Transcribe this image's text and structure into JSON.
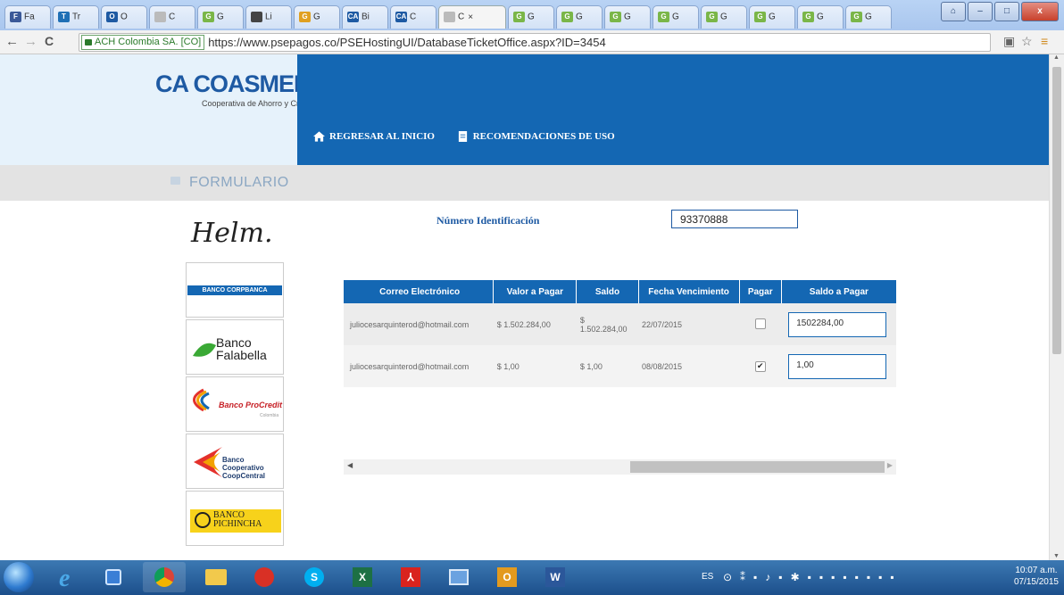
{
  "browser": {
    "tabs": [
      {
        "label": "Fa",
        "fav": "F",
        "color": "#3b5998"
      },
      {
        "label": "Tr",
        "fav": "T",
        "color": "#1f6fb5"
      },
      {
        "label": "O",
        "fav": "O",
        "color": "#1e5aa3"
      },
      {
        "label": "C",
        "fav": "",
        "color": "#bbbbbb"
      },
      {
        "label": "G",
        "fav": "G",
        "color": "#7ab648"
      },
      {
        "label": "Li",
        "fav": "",
        "color": "#444444"
      },
      {
        "label": "G",
        "fav": "G",
        "color": "#e0a020"
      },
      {
        "label": "Bi",
        "fav": "CA",
        "color": "#1e5aa3"
      },
      {
        "label": "C",
        "fav": "CA",
        "color": "#1e5aa3"
      },
      {
        "label": "C",
        "fav": "",
        "color": "#bbbbbb",
        "active": true
      },
      {
        "label": "G",
        "fav": "G",
        "color": "#7ab648"
      },
      {
        "label": "G",
        "fav": "G",
        "color": "#7ab648"
      },
      {
        "label": "G",
        "fav": "G",
        "color": "#7ab648"
      },
      {
        "label": "G",
        "fav": "G",
        "color": "#7ab648"
      },
      {
        "label": "G",
        "fav": "G",
        "color": "#7ab648"
      },
      {
        "label": "G",
        "fav": "G",
        "color": "#7ab648"
      },
      {
        "label": "G",
        "fav": "G",
        "color": "#7ab648"
      },
      {
        "label": "G",
        "fav": "G",
        "color": "#7ab648"
      }
    ],
    "ev_label": "ACH Colombia SA. [CO]",
    "url": "https://www.psepagos.co/PSEHostingUI/DatabaseTicketOffice.aspx?ID=3454"
  },
  "header": {
    "logo_main": "COASMEDAS",
    "logo_sub": "Cooperativa de Ahorro y Crédito",
    "nav": [
      {
        "label": "REGRESAR AL INICIO",
        "icon": "home-icon"
      },
      {
        "label": "RECOMENDACIONES DE USO",
        "icon": "document-icon"
      }
    ]
  },
  "form": {
    "title": "FORMULARIO",
    "id_label": "Número Identificación",
    "id_value": "93370888"
  },
  "banks": [
    {
      "name": "Helm."
    },
    {
      "name": "BANCO CORPBANCA"
    },
    {
      "name": "Banco Falabella"
    },
    {
      "name": "Banco ProCredit",
      "sub": "Colombia"
    },
    {
      "name": "Banco Cooperativo CoopCentral"
    },
    {
      "name": "BANCO PICHINCHA"
    }
  ],
  "table": {
    "headers": [
      "Correo Electrónico",
      "Valor a Pagar",
      "Saldo",
      "Fecha Vencimiento",
      "Pagar",
      "Saldo a Pagar"
    ],
    "rows": [
      {
        "email": "juliocesarquinterod@hotmail.com",
        "valor": "$ 1.502.284,00",
        "saldo_a": "$",
        "saldo_b": "1.502.284,00",
        "fecha": "22/07/2015",
        "pagar": false,
        "saldo_pagar": "1502284,00"
      },
      {
        "email": "juliocesarquinterod@hotmail.com",
        "valor": "$ 1,00",
        "saldo_a": "$ 1,00",
        "saldo_b": "",
        "fecha": "08/08/2015",
        "pagar": true,
        "saldo_pagar": "1,00"
      }
    ]
  },
  "taskbar": {
    "lang": "ES",
    "time": "10:07 a.m.",
    "date": "07/15/2015"
  }
}
